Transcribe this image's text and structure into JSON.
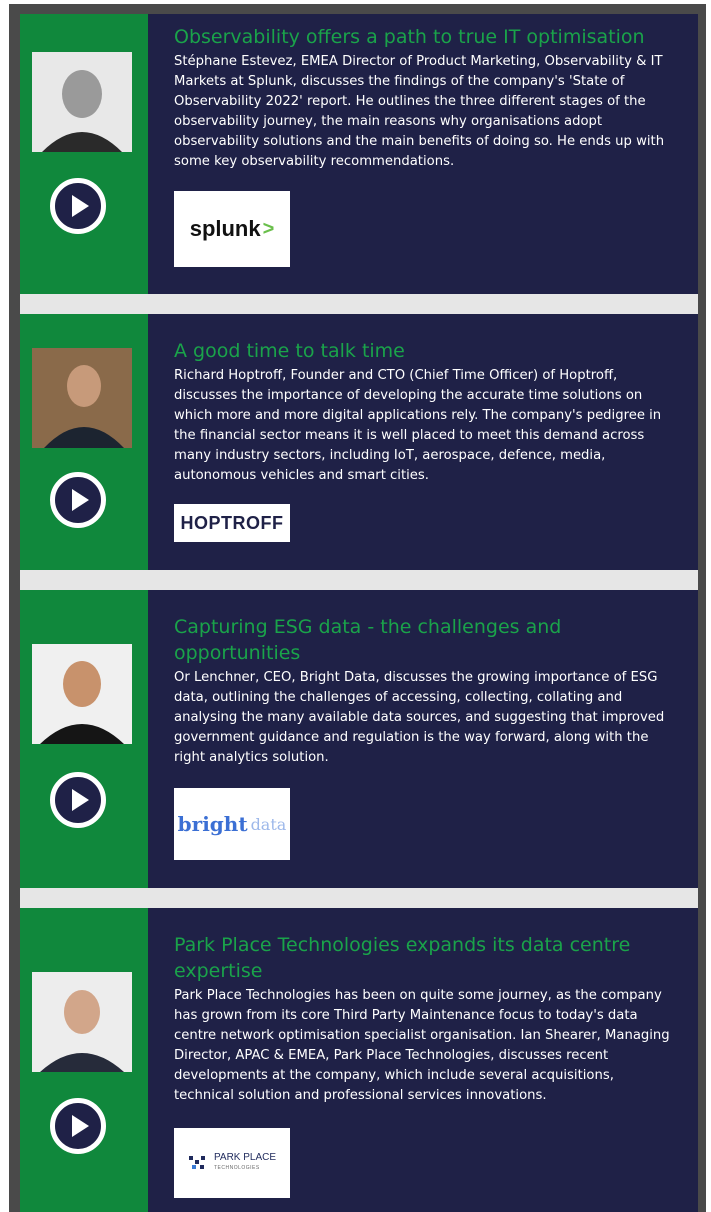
{
  "articles": [
    {
      "title": "Observability offers a path to true IT optimisation",
      "body": "Stéphane Estevez, EMEA Director of Product Marketing, Observability & IT Markets at Splunk, discusses the findings of the company's 'State of Observability 2022' report. He outlines the three different stages of the observability journey, the main reasons why organisations adopt observability solutions and the main benefits of doing so. He ends up with some key observability recommendations.",
      "logo_text": "splunk",
      "logo_mark": ">"
    },
    {
      "title": "A good time to talk time",
      "body": "Richard Hoptroff, Founder and CTO (Chief Time Officer) of Hoptroff, discusses the importance of developing the accurate time solutions on which more and more digital applications rely. The company's pedigree in the financial sector means it is well placed to meet this demand across many industry sectors, including IoT, aerospace, defence, media, autonomous vehicles and smart cities.",
      "logo_text": "HOPTROFF"
    },
    {
      "title": "Capturing ESG data - the challenges and opportunities",
      "body": "Or Lenchner, CEO, Bright Data, discusses the growing importance of ESG data, outlining the challenges of accessing, collecting, collating and analysing the many available data sources, and suggesting that improved government guidance and regulation is the way forward, along with the right analytics solution.",
      "logo_text": "bright",
      "logo_text2": "data"
    },
    {
      "title": "Park Place Technologies expands its data centre expertise",
      "body": "Park Place Technologies has been on quite some journey, as the company has grown from its core Third Party Maintenance focus to today's data centre network optimisation specialist organisation. Ian Shearer, Managing Director, APAC & EMEA, Park Place Technologies, discusses recent developments at the company, which include several acquisitions, technical solution and professional services innovations.",
      "logo_text": "PARK PLACE",
      "logo_sub": "TECHNOLOGIES"
    }
  ]
}
